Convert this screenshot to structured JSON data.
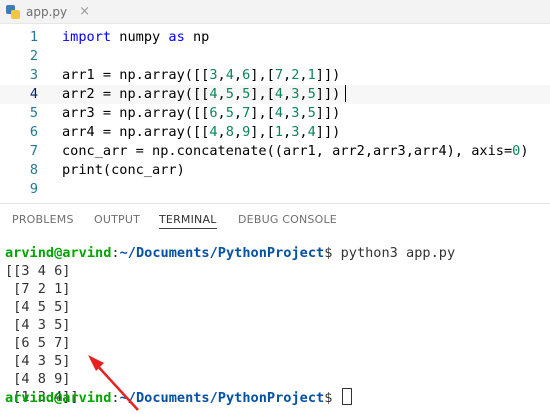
{
  "tab": {
    "filename": "app.py",
    "close": "×"
  },
  "editor": {
    "current_line": 4,
    "lines": [
      {
        "n": "1",
        "tokens": [
          {
            "t": "import",
            "c": "kw"
          },
          {
            "t": " numpy "
          },
          {
            "t": "as",
            "c": "kw"
          },
          {
            "t": " np"
          }
        ]
      },
      {
        "n": "2",
        "tokens": []
      },
      {
        "n": "3",
        "tokens": [
          {
            "t": "arr1 = np.array([["
          },
          {
            "t": "3",
            "c": "num"
          },
          {
            "t": ","
          },
          {
            "t": "4",
            "c": "num"
          },
          {
            "t": ","
          },
          {
            "t": "6",
            "c": "num"
          },
          {
            "t": "],["
          },
          {
            "t": "7",
            "c": "num"
          },
          {
            "t": ","
          },
          {
            "t": "2",
            "c": "num"
          },
          {
            "t": ","
          },
          {
            "t": "1",
            "c": "num"
          },
          {
            "t": "]])"
          }
        ]
      },
      {
        "n": "4",
        "tokens": [
          {
            "t": "arr2 = np.array([["
          },
          {
            "t": "4",
            "c": "num"
          },
          {
            "t": ","
          },
          {
            "t": "5",
            "c": "num"
          },
          {
            "t": ","
          },
          {
            "t": "5",
            "c": "num"
          },
          {
            "t": "],["
          },
          {
            "t": "4",
            "c": "num"
          },
          {
            "t": ","
          },
          {
            "t": "3",
            "c": "num"
          },
          {
            "t": ","
          },
          {
            "t": "5",
            "c": "num"
          },
          {
            "t": "]])"
          }
        ]
      },
      {
        "n": "5",
        "tokens": [
          {
            "t": "arr3 = np.array([["
          },
          {
            "t": "6",
            "c": "num"
          },
          {
            "t": ","
          },
          {
            "t": "5",
            "c": "num"
          },
          {
            "t": ","
          },
          {
            "t": "7",
            "c": "num"
          },
          {
            "t": "],["
          },
          {
            "t": "4",
            "c": "num"
          },
          {
            "t": ","
          },
          {
            "t": "3",
            "c": "num"
          },
          {
            "t": ","
          },
          {
            "t": "5",
            "c": "num"
          },
          {
            "t": "]])"
          }
        ]
      },
      {
        "n": "6",
        "tokens": [
          {
            "t": "arr4 = np.array([["
          },
          {
            "t": "4",
            "c": "num"
          },
          {
            "t": ","
          },
          {
            "t": "8",
            "c": "num"
          },
          {
            "t": ","
          },
          {
            "t": "9",
            "c": "num"
          },
          {
            "t": "],["
          },
          {
            "t": "1",
            "c": "num"
          },
          {
            "t": ","
          },
          {
            "t": "3",
            "c": "num"
          },
          {
            "t": ","
          },
          {
            "t": "4",
            "c": "num"
          },
          {
            "t": "]])"
          }
        ]
      },
      {
        "n": "7",
        "tokens": [
          {
            "t": "conc_arr = np.concatenate((arr1, arr2,arr3,arr4), axis="
          },
          {
            "t": "0",
            "c": "num"
          },
          {
            "t": ")"
          }
        ]
      },
      {
        "n": "8",
        "tokens": [
          {
            "t": "print(conc_arr)"
          }
        ]
      },
      {
        "n": "9",
        "tokens": []
      }
    ]
  },
  "panel": {
    "tabs": [
      "PROBLEMS",
      "OUTPUT",
      "TERMINAL",
      "DEBUG CONSOLE"
    ],
    "active_tab": "TERMINAL"
  },
  "terminal": {
    "prompt_user": "arvind@arvind",
    "prompt_sep": ":",
    "prompt_path": "~/Documents/PythonProject",
    "prompt_symbol": "$",
    "command": " python3 app.py",
    "output": [
      "[[3 4 6]",
      " [7 2 1]",
      " [4 5 5]",
      " [4 3 5]",
      " [6 5 7]",
      " [4 3 5]",
      " [4 8 9]",
      " [1 3 4]]"
    ]
  },
  "colors": {
    "keyword": "#0000ff",
    "number": "#098658",
    "prompt_user": "#00a600",
    "prompt_path": "#0451a5",
    "arrow": "#e8201e"
  }
}
